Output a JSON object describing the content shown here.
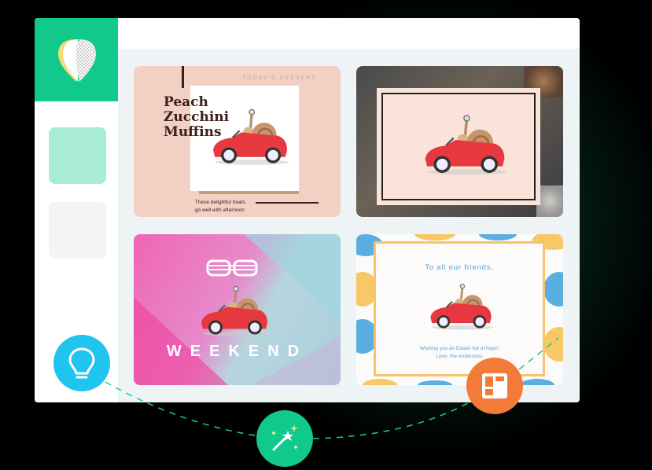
{
  "cards": [
    {
      "label": "TODAY'S DESSERT",
      "title_lines": [
        "Peach",
        "Zucchini",
        "Muffins"
      ],
      "caption_lines": [
        "These delightful treats",
        "go well with afternoon"
      ]
    },
    {
      "label": "photo-frame-card"
    },
    {
      "headline": "WEEKEND"
    },
    {
      "greeting": "To all our friends,",
      "message_lines": [
        "Wishing you an Easter full of hope!",
        "Love, the Andersons"
      ]
    }
  ],
  "colors": {
    "brand_green": "#11c98c",
    "bulb_blue": "#1fc4ef",
    "orange": "#f47a3a"
  },
  "icons": [
    "logo-icon",
    "lightbulb-icon",
    "magic-wand-icon",
    "layout-icon"
  ]
}
